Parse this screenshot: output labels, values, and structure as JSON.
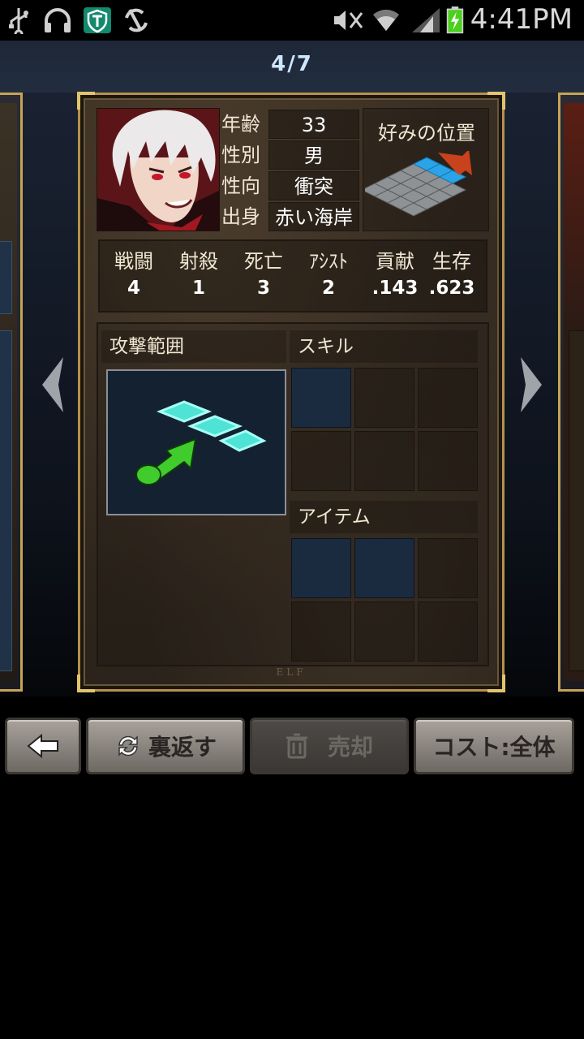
{
  "status_bar": {
    "time": "4:41PM",
    "icons": [
      "usb-icon",
      "headphones-icon",
      "vpn-shield-icon",
      "sync-off-icon",
      "mute-icon",
      "wifi-icon",
      "signal-icon",
      "battery-charging-icon"
    ]
  },
  "header": {
    "page_indicator": "4/7"
  },
  "profile": {
    "labels": [
      "年齢",
      "性別",
      "性向",
      "出身"
    ],
    "values": [
      "33",
      "男",
      "衝突",
      "赤い海岸"
    ],
    "preferred_position_title": "好みの位置"
  },
  "stats": [
    {
      "label": "戦闘",
      "value": "4"
    },
    {
      "label": "射殺",
      "value": "1"
    },
    {
      "label": "死亡",
      "value": "3"
    },
    {
      "label": "ｱｼｽﾄ",
      "value": "2"
    },
    {
      "label": "貢献",
      "value": ".143"
    },
    {
      "label": "生存",
      "value": ".623"
    }
  ],
  "sections": {
    "attack_range": "攻撃範囲",
    "skills": "スキル",
    "items": "アイテム"
  },
  "emblem": "ELF",
  "buttons": {
    "back": "back-arrow-icon",
    "flip": "裏返す",
    "sell": "売却",
    "cost": "コスト:全体"
  },
  "colors": {
    "card_border": "#b5924a",
    "tile_cyan": "#4fe3d6",
    "arrow_green": "#3fcc2c",
    "button_face": "#a8a29b"
  }
}
